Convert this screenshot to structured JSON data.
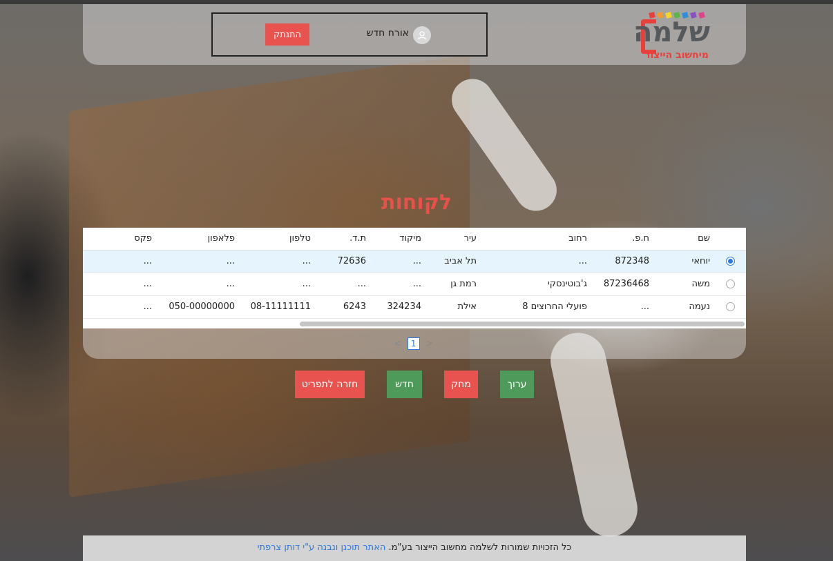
{
  "header": {
    "logo_name": "שלמה",
    "logo_sub": "מיחשוב הייצור",
    "logo_colors": [
      "#e8413c",
      "#f29a2e",
      "#f5d327",
      "#5bb547",
      "#2f8fd8",
      "#8a4fc3",
      "#e0458c"
    ],
    "user_name": "אורח חדש",
    "user_icon": "user-icon",
    "logout_label": "התנתק"
  },
  "page": {
    "title": "לקוחות"
  },
  "table": {
    "columns": [
      "שם",
      "ח.פ.",
      "רחוב",
      "עיר",
      "מיקוד",
      "ת.ד.",
      "טלפון",
      "פלאפון",
      "פקס"
    ],
    "rows": [
      {
        "selected": true,
        "name": "יוחאי",
        "tz": "872348",
        "street": "...",
        "city": "תל אביב",
        "zip": "...",
        "pobox": "72636",
        "phone": "...",
        "mobile": "...",
        "fax": "..."
      },
      {
        "selected": false,
        "name": "משה",
        "tz": "87236468",
        "street": "ג'בוטינסקי",
        "city": "רמת גן",
        "zip": "...",
        "pobox": "...",
        "phone": "...",
        "mobile": "...",
        "fax": "..."
      },
      {
        "selected": false,
        "name": "נעמה",
        "tz": "...",
        "street": "פועלי החרוצים 8",
        "city": "אילת",
        "zip": "324234",
        "pobox": "6243",
        "phone": "08-11111111",
        "mobile": "050-00000000",
        "fax": "..."
      }
    ]
  },
  "pager": {
    "prev": "<",
    "current": "1",
    "next": ">"
  },
  "actions": {
    "edit": "ערוך",
    "delete": "מחק",
    "new": "חדש",
    "back": "חזרה לתפריט"
  },
  "footer": {
    "rights": "כל הזכויות שמורות לשלמה מחשוב הייצור בע\"מ.",
    "credit": "האתר תוכנן ונבנה ע\"י דותן צרפתי"
  }
}
